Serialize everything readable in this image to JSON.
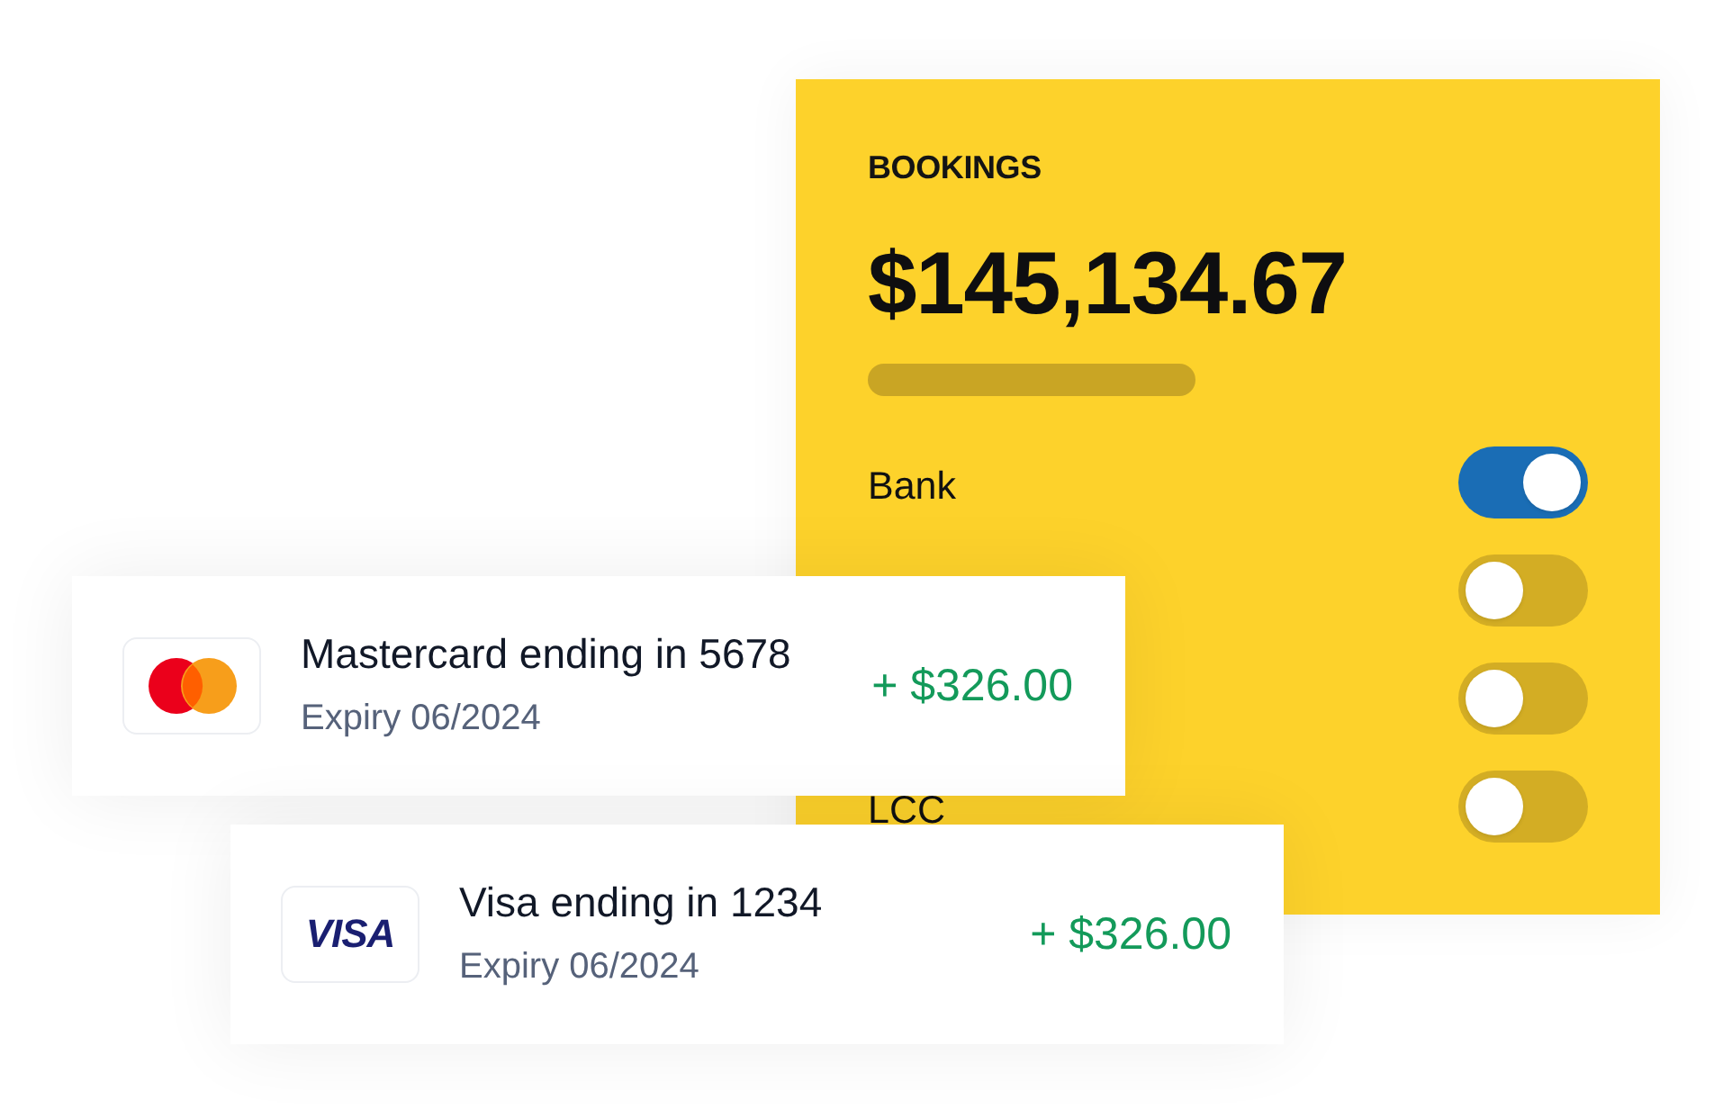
{
  "bookings_panel": {
    "title": "BOOKINGS",
    "amount": "$145,134.67",
    "toggles": [
      {
        "label": "Bank",
        "on": true
      },
      {
        "on": false
      },
      {
        "on": false
      },
      {
        "label": "LCC",
        "on": false
      }
    ]
  },
  "payment_cards": [
    {
      "kind": "mastercard",
      "title": "Mastercard ending in 5678",
      "expiry": "Expiry 06/2024",
      "amount": "+ $326.00"
    },
    {
      "kind": "visa",
      "logo_text": "VISA",
      "title": "Visa ending in 1234",
      "expiry": "Expiry 06/2024",
      "amount": "+ $326.00"
    }
  ]
}
